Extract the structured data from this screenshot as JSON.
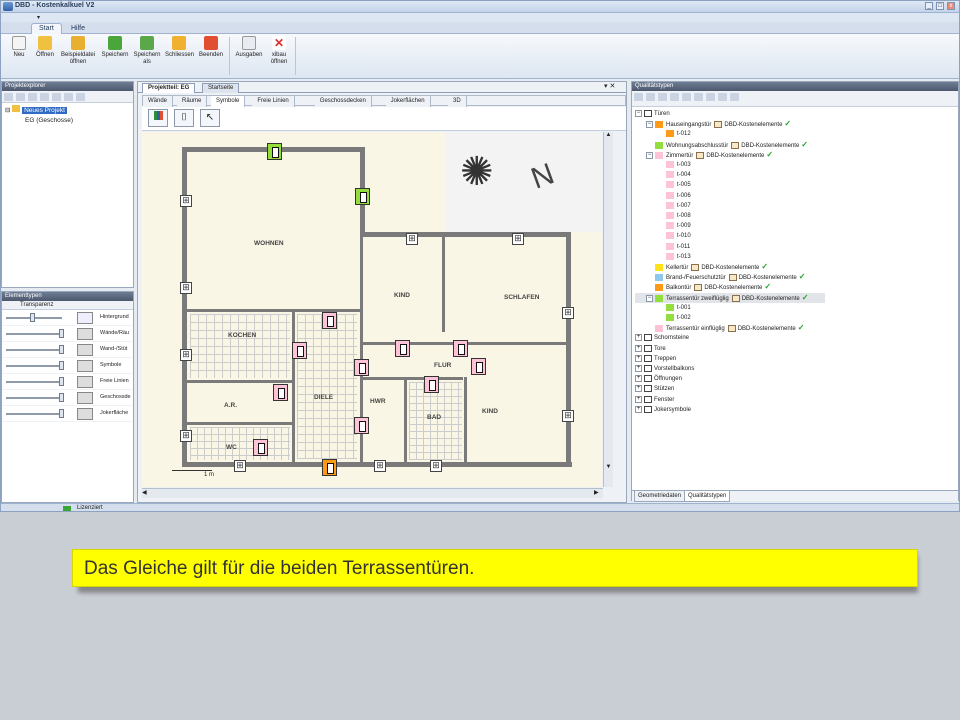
{
  "window": {
    "title": "DBD - Kostenkalkuel V2",
    "minimize": "_",
    "maximize": "□",
    "close": "x"
  },
  "ribbon": {
    "tabs": [
      "Start",
      "Hilfe"
    ],
    "buttons": [
      {
        "label": "Neu",
        "icon": "new-file-icon",
        "color": "#f4f4f4"
      },
      {
        "label": "Öffnen",
        "icon": "open-folder-icon",
        "color": "#f0c040"
      },
      {
        "label": "Beispieldatei öffnen",
        "icon": "sample-folder-icon",
        "color": "#e8b030"
      },
      {
        "label": "Speichern",
        "icon": "save-check-icon",
        "color": "#4aa63a"
      },
      {
        "label": "Speichern als",
        "icon": "save-as-icon",
        "color": "#5aa84a"
      },
      {
        "label": "Schliessen",
        "icon": "close-folder-icon",
        "color": "#f0b030"
      },
      {
        "label": "Beenden",
        "icon": "exit-icon",
        "color": "#e05030"
      },
      {
        "label": "Ausgaben",
        "icon": "output-doc-icon",
        "color": "#e8ecf2"
      },
      {
        "label": "xibau öffnen",
        "icon": "xibau-icon",
        "color": "#d83030"
      }
    ]
  },
  "project_explorer": {
    "header": "Projektexplorer",
    "root": "Neues Projekt",
    "child": "EG (Geschosse)"
  },
  "element_types": {
    "header": "Elementtypen",
    "column": "Transparenz",
    "rows": [
      {
        "label": "Hintergrund",
        "level": 0.45,
        "icon": "background-icon"
      },
      {
        "label": "Wände/Räu",
        "level": 1.0,
        "icon": "walls-icon"
      },
      {
        "label": "Wand-/Stüt",
        "level": 1.0,
        "icon": "wall-support-icon"
      },
      {
        "label": "Symbole",
        "level": 1.0,
        "icon": "symbols-icon"
      },
      {
        "label": "Freie Linien",
        "level": 1.0,
        "icon": "free-lines-icon"
      },
      {
        "label": "Geschossde",
        "level": 1.0,
        "icon": "floor-slab-icon"
      },
      {
        "label": "Jokerfläche",
        "level": 1.0,
        "icon": "joker-area-icon"
      }
    ]
  },
  "center": {
    "doc_tabs": [
      "Projektteil: EG",
      "Startseite"
    ],
    "sub_tabs": [
      "Wände",
      "Räume",
      "Symbole",
      "Freie Linien",
      "Geschossdecken",
      "Jokerflächen",
      "3D"
    ],
    "active_sub_tab": "Symbole",
    "rooms": [
      "WOHNEN",
      "KIND",
      "SCHLAFEN",
      "KOCHEN",
      "FLUR",
      "A.R.",
      "DIELE",
      "HWR",
      "BAD",
      "KIND",
      "WC"
    ],
    "scale_label": "1 m"
  },
  "quality_types": {
    "header": "Qualitätstypen",
    "rows": [
      {
        "label": "Türen",
        "indent": 0,
        "exp": "⊟",
        "icon": "door-icon"
      },
      {
        "label": "Hauseingangstür",
        "indent": 1,
        "exp": "⊟",
        "swatch": "#ff9a16",
        "doc": "DBD-Kostenelemente",
        "check": true
      },
      {
        "label": "t-012",
        "indent": 2,
        "swatch": "#ff9a16"
      },
      {
        "label": "Wohnungsabschlusstür",
        "indent": 1,
        "swatch": "#93dd3d",
        "doc": "DBD-Kostenelemente",
        "check": true
      },
      {
        "label": "Zimmertür",
        "indent": 1,
        "exp": "⊟",
        "swatch": "#ffc3d8",
        "doc": "DBD-Kostenelemente",
        "check": true
      },
      {
        "label": "t-003",
        "indent": 2,
        "swatch": "#ffc3d8"
      },
      {
        "label": "t-004",
        "indent": 2,
        "swatch": "#ffc3d8"
      },
      {
        "label": "t-005",
        "indent": 2,
        "swatch": "#ffc3d8"
      },
      {
        "label": "t-006",
        "indent": 2,
        "swatch": "#ffc3d8"
      },
      {
        "label": "t-007",
        "indent": 2,
        "swatch": "#ffc3d8"
      },
      {
        "label": "t-008",
        "indent": 2,
        "swatch": "#ffc3d8"
      },
      {
        "label": "t-009",
        "indent": 2,
        "swatch": "#ffc3d8"
      },
      {
        "label": "t-010",
        "indent": 2,
        "swatch": "#ffc3d8"
      },
      {
        "label": "t-011",
        "indent": 2,
        "swatch": "#ffc3d8"
      },
      {
        "label": "t-013",
        "indent": 2,
        "swatch": "#ffc3d8"
      },
      {
        "label": "Kellertür",
        "indent": 1,
        "swatch": "#ffe21a",
        "doc": "DBD-Kostenelemente",
        "check": true
      },
      {
        "label": "Brand-/Feuerschutztür",
        "indent": 1,
        "swatch": "#8fc7ef",
        "doc": "DBD-Kostenelemente",
        "check": true
      },
      {
        "label": "Balkontür",
        "indent": 1,
        "swatch": "#ff9a16",
        "doc": "DBD-Kostenelemente",
        "check": true
      },
      {
        "label": "Terrassentür zweiflüglig",
        "indent": 1,
        "exp": "⊟",
        "swatch": "#93dd3d",
        "doc": "DBD-Kostenelemente",
        "check": true,
        "selected": true
      },
      {
        "label": "t-001",
        "indent": 2,
        "swatch": "#93dd3d"
      },
      {
        "label": "t-002",
        "indent": 2,
        "swatch": "#93dd3d"
      },
      {
        "label": "Terrassentür einflüglig",
        "indent": 1,
        "swatch": "#ffc3d8",
        "doc": "DBD-Kostenelemente",
        "check": true
      },
      {
        "label": "Schornsteine",
        "indent": 0,
        "exp": "⊞",
        "icon": "chimney-icon"
      },
      {
        "label": "Tore",
        "indent": 0,
        "exp": "⊞",
        "icon": "gate-icon"
      },
      {
        "label": "Treppen",
        "indent": 0,
        "exp": "⊞",
        "icon": "stairs-icon"
      },
      {
        "label": "Vorstellbalkons",
        "indent": 0,
        "exp": "⊞",
        "icon": "balcony-icon"
      },
      {
        "label": "Öffnungen",
        "indent": 0,
        "exp": "⊞",
        "icon": "opening-icon"
      },
      {
        "label": "Stützen",
        "indent": 0,
        "exp": "⊞",
        "icon": "column-icon"
      },
      {
        "label": "Fenster",
        "indent": 0,
        "exp": "⊞",
        "icon": "window-icon"
      },
      {
        "label": "Jokersymbole",
        "indent": 0,
        "exp": "⊞",
        "icon": "joker-icon"
      }
    ],
    "bottom_tabs": [
      "Geometriedaten",
      "Qualitätstypen"
    ]
  },
  "status": {
    "text": "Lizenziert"
  },
  "caption": {
    "text": "Das Gleiche gilt für die beiden Terrassentüren."
  }
}
